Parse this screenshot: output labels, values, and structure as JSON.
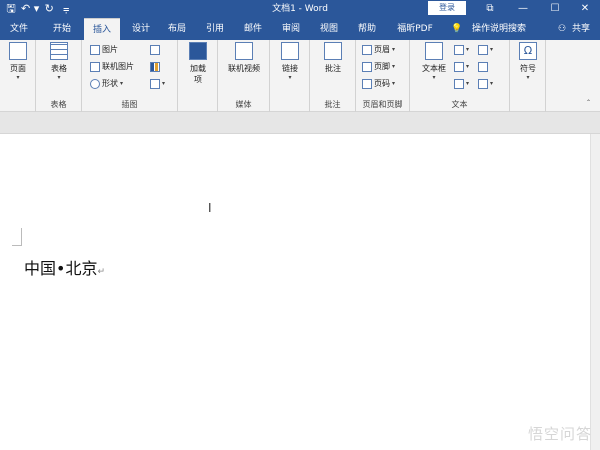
{
  "window": {
    "title": "文档1 - Word",
    "login": "登录",
    "controls": [
      "⧉",
      "—",
      "☐",
      "✕"
    ]
  },
  "qat": {
    "save": "🖫",
    "undo": "↶ ▾",
    "redo": "↻",
    "customize": "⩦"
  },
  "tabs": [
    "文件",
    "开始",
    "插入",
    "设计",
    "布局",
    "引用",
    "邮件",
    "审阅",
    "视图",
    "帮助",
    "福昕PDF"
  ],
  "active_tab": "插入",
  "tellme": "操作说明搜索",
  "share": "共享",
  "ribbon": {
    "pages": {
      "btn": "页面",
      "label": ""
    },
    "tables": {
      "btn": "表格",
      "label": "表格"
    },
    "illustrations": {
      "items": [
        "图片",
        "联机图片",
        "形状"
      ],
      "label": "插图"
    },
    "addins": {
      "btn": "加载项"
    },
    "media": {
      "btn": "联机视频",
      "label": "媒体"
    },
    "links": {
      "btn": "链接"
    },
    "comments": {
      "btn": "批注",
      "label": "批注"
    },
    "header_footer": {
      "items": [
        "页眉",
        "页脚",
        "页码"
      ],
      "label": "页眉和页脚"
    },
    "text": {
      "btn": "文本框",
      "label": "文本"
    },
    "symbols": {
      "btn": "符号"
    }
  },
  "document": {
    "text": "中国•北京",
    "paragraph_mark": "↵"
  },
  "watermark": "悟空问答"
}
